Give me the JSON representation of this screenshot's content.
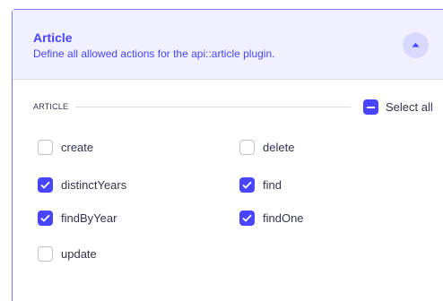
{
  "header": {
    "title": "Article",
    "description": "Define all allowed actions for the api::article plugin."
  },
  "section": {
    "label": "ARTICLE",
    "select_all_label": "Select all"
  },
  "actions": [
    {
      "label": "create",
      "checked": false
    },
    {
      "label": "delete",
      "checked": false
    },
    {
      "label": "distinctYears",
      "checked": true
    },
    {
      "label": "find",
      "checked": true
    },
    {
      "label": "findByYear",
      "checked": true
    },
    {
      "label": "findOne",
      "checked": true
    },
    {
      "label": "update",
      "checked": false
    }
  ],
  "colors": {
    "accent": "#4945ff",
    "header_bg": "#f0f0ff",
    "text": "#32324d"
  }
}
